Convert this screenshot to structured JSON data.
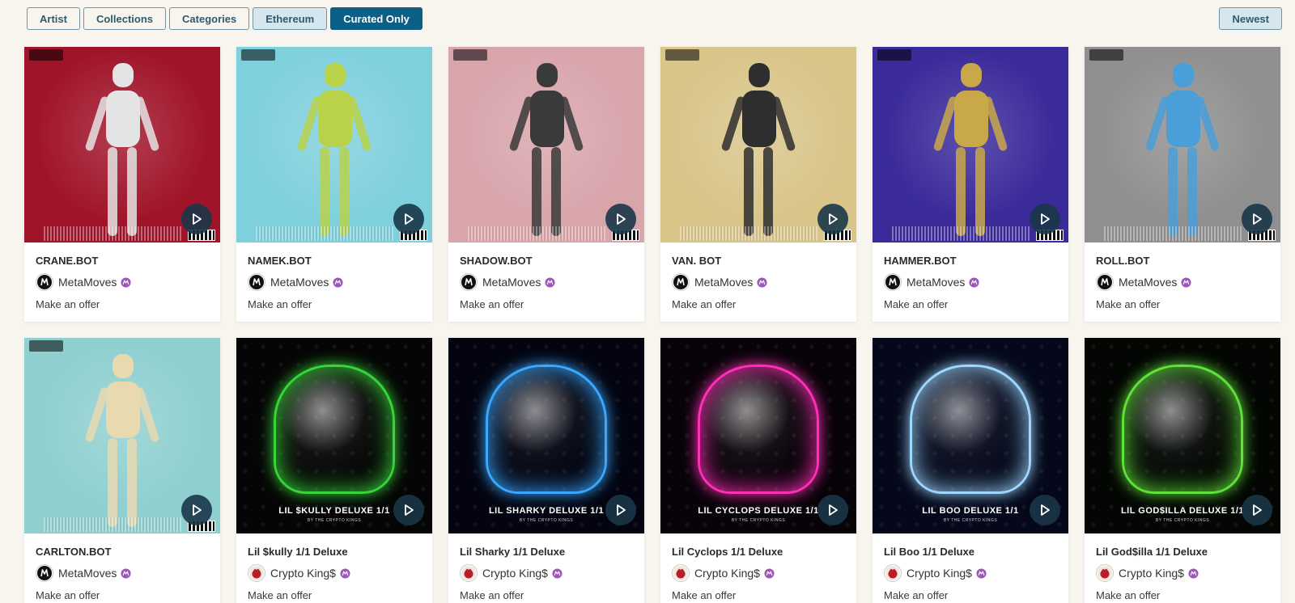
{
  "filters": {
    "artist": "Artist",
    "collections": "Collections",
    "categories": "Categories",
    "ethereum": "Ethereum",
    "curated_only": "Curated Only"
  },
  "sort": {
    "label": "Newest"
  },
  "colors": {
    "accent": "#0d5f86",
    "button_border": "#6f94a6",
    "background": "#f8f5ef",
    "badge": "#9b59b6",
    "play_button": "#1a3648"
  },
  "cards": [
    {
      "title": "CRANE.BOT",
      "creator": "MetaMoves",
      "price": "Make an offer",
      "creator_icon": "metamoves-logo",
      "art": "robot",
      "bg": "#a0142a",
      "robot": "#e4e4e4"
    },
    {
      "title": "NAMEK.BOT",
      "creator": "MetaMoves",
      "price": "Make an offer",
      "creator_icon": "metamoves-logo",
      "art": "robot",
      "bg": "#7fd0dd",
      "robot": "#b8d24a"
    },
    {
      "title": "SHADOW.BOT",
      "creator": "MetaMoves",
      "price": "Make an offer",
      "creator_icon": "metamoves-logo",
      "art": "robot",
      "bg": "#d8a5ab",
      "robot": "#3a3a3a"
    },
    {
      "title": "VAN. BOT",
      "creator": "MetaMoves",
      "price": "Make an offer",
      "creator_icon": "metamoves-logo",
      "art": "robot",
      "bg": "#d9c58a",
      "robot": "#2e2e2e"
    },
    {
      "title": "HAMMER.BOT",
      "creator": "MetaMoves",
      "price": "Make an offer",
      "creator_icon": "metamoves-logo",
      "art": "robot",
      "bg": "#3a2a9a",
      "robot": "#c9a84a"
    },
    {
      "title": "ROLL.BOT",
      "creator": "MetaMoves",
      "price": "Make an offer",
      "creator_icon": "metamoves-logo",
      "art": "robot",
      "bg": "#8f8f8f",
      "robot": "#4a9fd8"
    },
    {
      "title": "CARLTON.BOT",
      "creator": "MetaMoves",
      "price": "Make an offer",
      "creator_icon": "metamoves-logo",
      "art": "robot",
      "bg": "#8fcfd0",
      "robot": "#e9d9b0"
    },
    {
      "title": "Lil $kully 1/1 Deluxe",
      "creator": "Crypto King$",
      "price": "Make an offer",
      "creator_icon": "crypto-kings-logo",
      "art": "ghost",
      "bg": "#050505",
      "glow": "#37d43a",
      "art_title": "LIL $KULLY DELUXE 1/1",
      "art_byline": "BY THE CRYPTO KINGS"
    },
    {
      "title": "Lil Sharky 1/1 Deluxe",
      "creator": "Crypto King$",
      "price": "Make an offer",
      "creator_icon": "crypto-kings-logo",
      "art": "ghost",
      "bg": "#030410",
      "glow": "#3aa8ff",
      "art_title": "LIL SHARKY DELUXE 1/1",
      "art_byline": "BY THE CRYPTO KINGS"
    },
    {
      "title": "Lil Cyclops 1/1 Deluxe",
      "creator": "Crypto King$",
      "price": "Make an offer",
      "creator_icon": "crypto-kings-logo",
      "art": "ghost",
      "bg": "#080308",
      "glow": "#ff2fb8",
      "art_title": "LIL CYCLOPS DELUXE 1/1",
      "art_byline": "BY THE CRYPTO KINGS"
    },
    {
      "title": "Lil Boo 1/1 Deluxe",
      "creator": "Crypto King$",
      "price": "Make an offer",
      "creator_icon": "crypto-kings-logo",
      "art": "ghost",
      "bg": "#04081a",
      "glow": "#9fd8ff",
      "art_title": "LIL BOO DELUXE 1/1",
      "art_byline": "BY THE CRYPTO KINGS"
    },
    {
      "title": "Lil God$illa 1/1 Deluxe",
      "creator": "Crypto King$",
      "price": "Make an offer",
      "creator_icon": "crypto-kings-logo",
      "art": "ghost",
      "bg": "#030603",
      "glow": "#5fe23a",
      "art_title": "LIL GOD$ILLA DELUXE 1/1",
      "art_byline": "BY THE CRYPTO KINGS"
    }
  ]
}
